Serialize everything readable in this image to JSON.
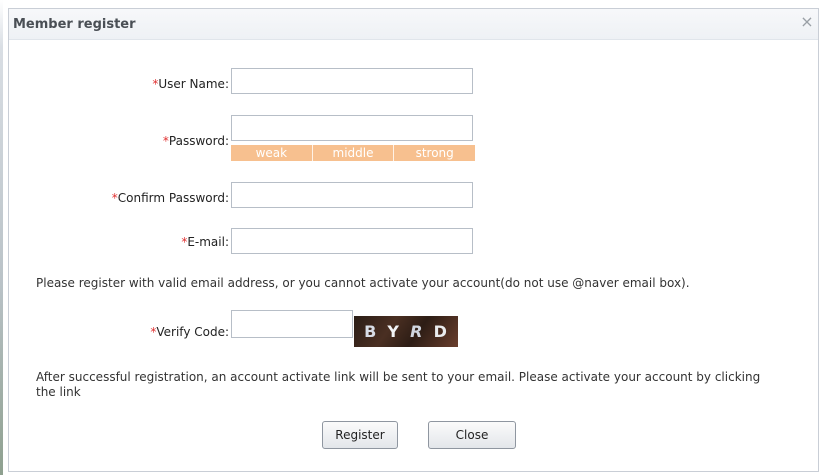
{
  "dialog": {
    "title": "Member register",
    "close_glyph": "×"
  },
  "form": {
    "required_mark": "*",
    "username_label": "User Name:",
    "password_label": "Password:",
    "confirm_label": "Confirm Password:",
    "email_label": "E-mail:",
    "verify_label": "Verify Code:",
    "username_value": "",
    "password_value": "",
    "confirm_value": "",
    "email_value": "",
    "verify_value": ""
  },
  "strength": {
    "weak": "weak",
    "middle": "middle",
    "strong": "strong"
  },
  "notes": {
    "email_note": "Please register with valid email address, or you cannot activate your account(do not use @naver email box).",
    "activation_note": "After successful registration, an account activate link will be sent to your email. Please activate your account by clicking the link"
  },
  "captcha": {
    "chars": [
      "B",
      "Y",
      "R",
      "D"
    ]
  },
  "buttons": {
    "register": "Register",
    "close": "Close"
  },
  "colors": {
    "required": "#e03030",
    "strength_bar": "#f7c08f"
  }
}
